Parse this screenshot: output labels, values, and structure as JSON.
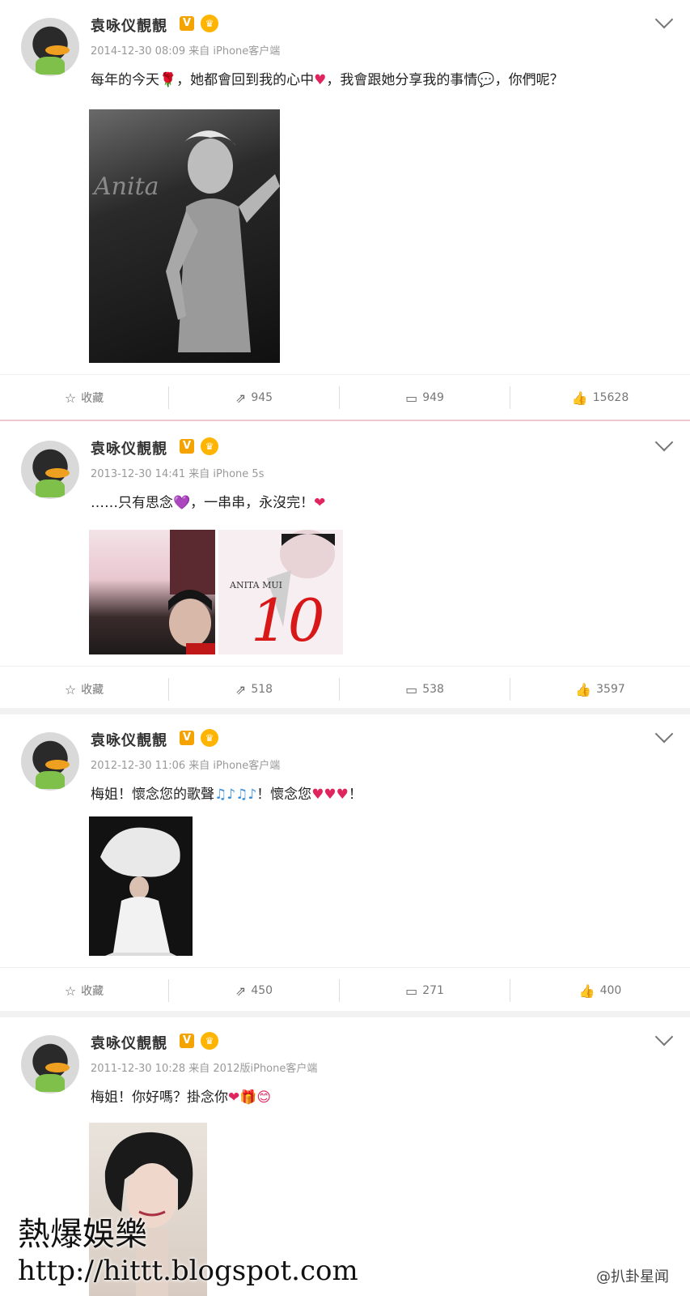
{
  "posts": [
    {
      "author": "袁咏仪靚靚",
      "badge_v": "V",
      "meta": "2014-12-30 08:09 来自 iPhone客户端",
      "text_parts": [
        "每年的今天",
        "🌹",
        "，她都會回到我的心中",
        "♥",
        "，我會跟她分享我的事情",
        "💬",
        "，你們呢？"
      ],
      "image_caption": "Anita",
      "actions": {
        "favorite": "收藏",
        "repost": "945",
        "comment": "949",
        "like": "15628"
      }
    },
    {
      "author": "袁咏仪靚靚",
      "badge_v": "V",
      "meta": "2013-12-30 14:41 来自 iPhone 5s",
      "text_parts": [
        "……只有思念",
        "💜",
        "，一串串，永沒完！",
        "❤"
      ],
      "image2_caption": "ANITA MUI",
      "image2_number": "10",
      "actions": {
        "favorite": "收藏",
        "repost": "518",
        "comment": "538",
        "like": "3597"
      }
    },
    {
      "author": "袁咏仪靚靚",
      "badge_v": "V",
      "meta": "2012-12-30 11:06 来自 iPhone客户端",
      "text_parts": [
        "梅姐！懷念您的歌聲",
        "♫♪♫♪",
        "！懷念您",
        "♥♥♥",
        "！"
      ],
      "actions": {
        "favorite": "收藏",
        "repost": "450",
        "comment": "271",
        "like": "400"
      }
    },
    {
      "author": "袁咏仪靚靚",
      "badge_v": "V",
      "meta": "2011-12-30 10:28 来自 2012版iPhone客户端",
      "text_parts": [
        "梅姐！你好嗎？掛念你",
        "❤🎁😊"
      ]
    }
  ],
  "watermark": {
    "title": "熱爆娛樂",
    "url": "http://hittt.blogspot.com",
    "source": "@扒卦星闻"
  },
  "colors": {
    "vbadge": "#f4a300",
    "heart": "#e0245e",
    "divider": "#f0c8d0"
  },
  "icons": [
    "chevron-down-icon",
    "star-icon",
    "repost-icon",
    "comment-icon",
    "like-icon"
  ]
}
